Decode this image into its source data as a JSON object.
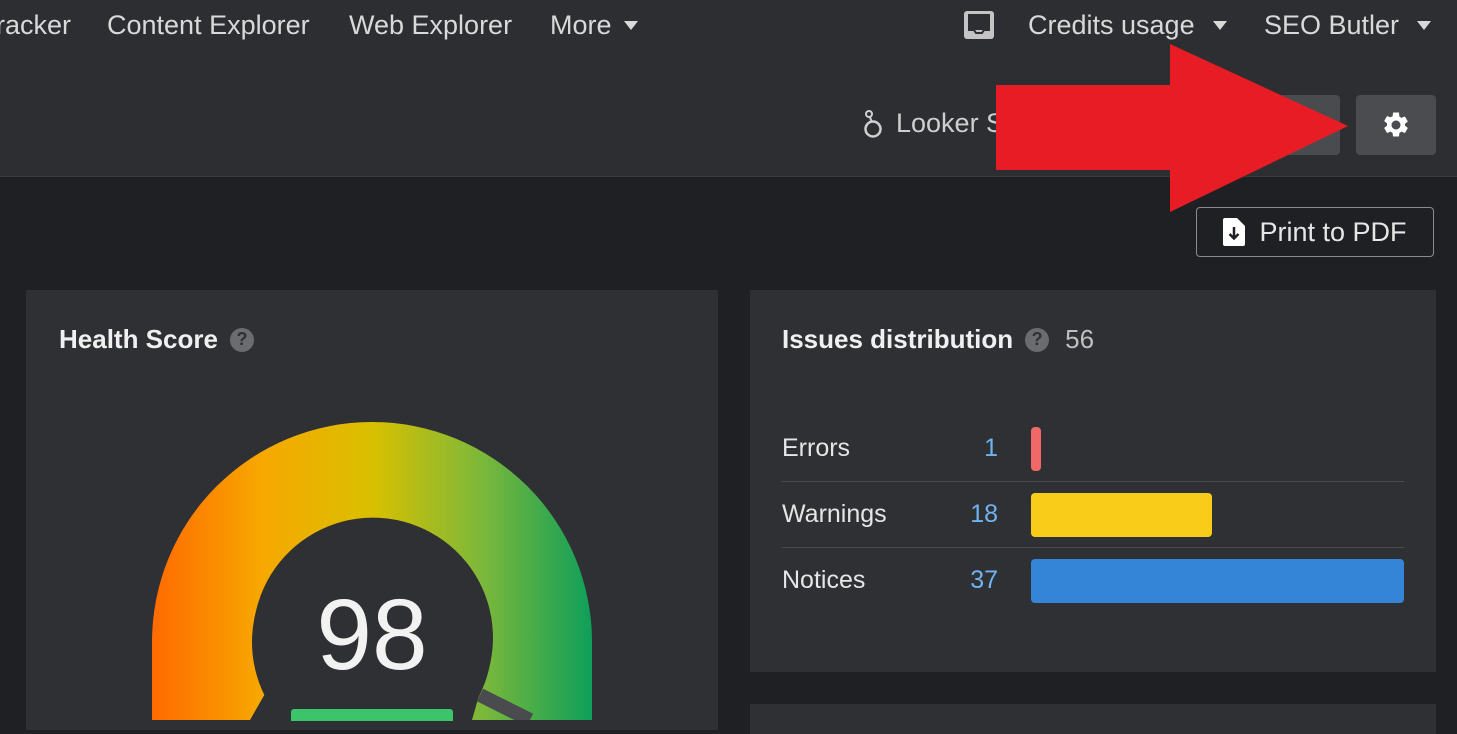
{
  "topnav": {
    "items": [
      "racker",
      "Content Explorer",
      "Web Explorer",
      "More"
    ],
    "credits_usage": "Credits usage",
    "account": "SEO Butler"
  },
  "subbar": {
    "looker_label": "Looker S"
  },
  "print_button": "Print to PDF",
  "health": {
    "title": "Health Score",
    "score": "98"
  },
  "issues": {
    "title": "Issues distribution",
    "total": "56",
    "rows": [
      {
        "label": "Errors",
        "count": "1",
        "value": 1,
        "color": "#f06868"
      },
      {
        "label": "Warnings",
        "count": "18",
        "value": 18,
        "color": "#f8cc18"
      },
      {
        "label": "Notices",
        "count": "37",
        "value": 37,
        "color": "#3484d8"
      }
    ]
  },
  "colors": {
    "annotation_arrow": "#e81c24",
    "score_badge": "#3cc46b"
  }
}
